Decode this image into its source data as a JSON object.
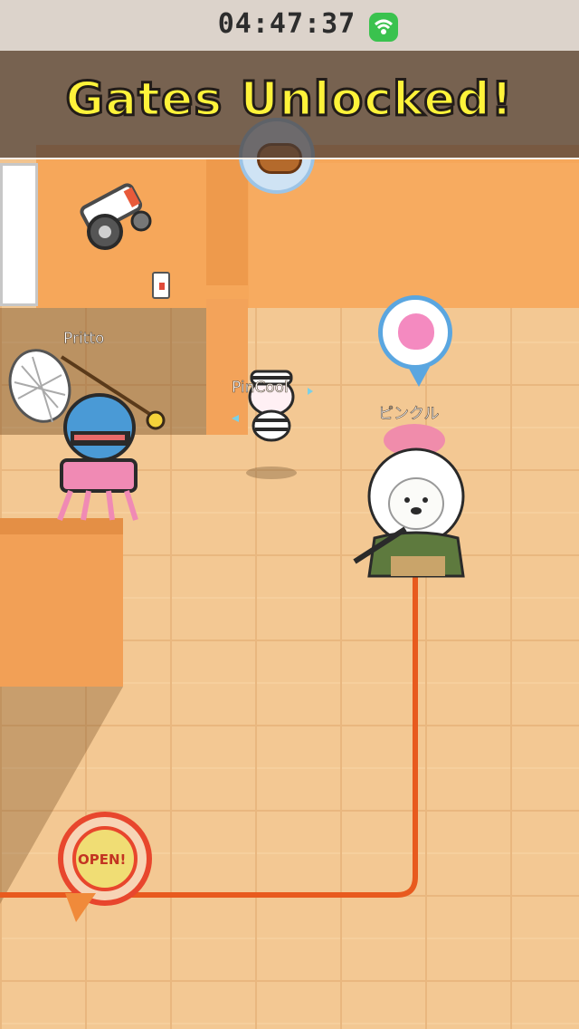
{
  "status_bar": {
    "clock": "04:47:37",
    "wifi_icon": "wifi-icon",
    "wifi_color": "#3ac24e"
  },
  "banner": {
    "title": "Gates Unlocked!",
    "text_color": "#fff33a"
  },
  "players": [
    {
      "name": "Pritto",
      "role": "robot-catcher"
    },
    {
      "name": "PinCool",
      "role": "striped-prisoner"
    },
    {
      "name": "ピンクル",
      "role": "white-lion-samurai"
    }
  ],
  "bubbles": {
    "bread_icon": "bread-icon",
    "poop_icon": "pink-poop-icon"
  },
  "gate": {
    "label": "OPEN!",
    "icon": "gate-door-icon",
    "accent_color": "#e8462d"
  },
  "route_color": "#e85a1e"
}
